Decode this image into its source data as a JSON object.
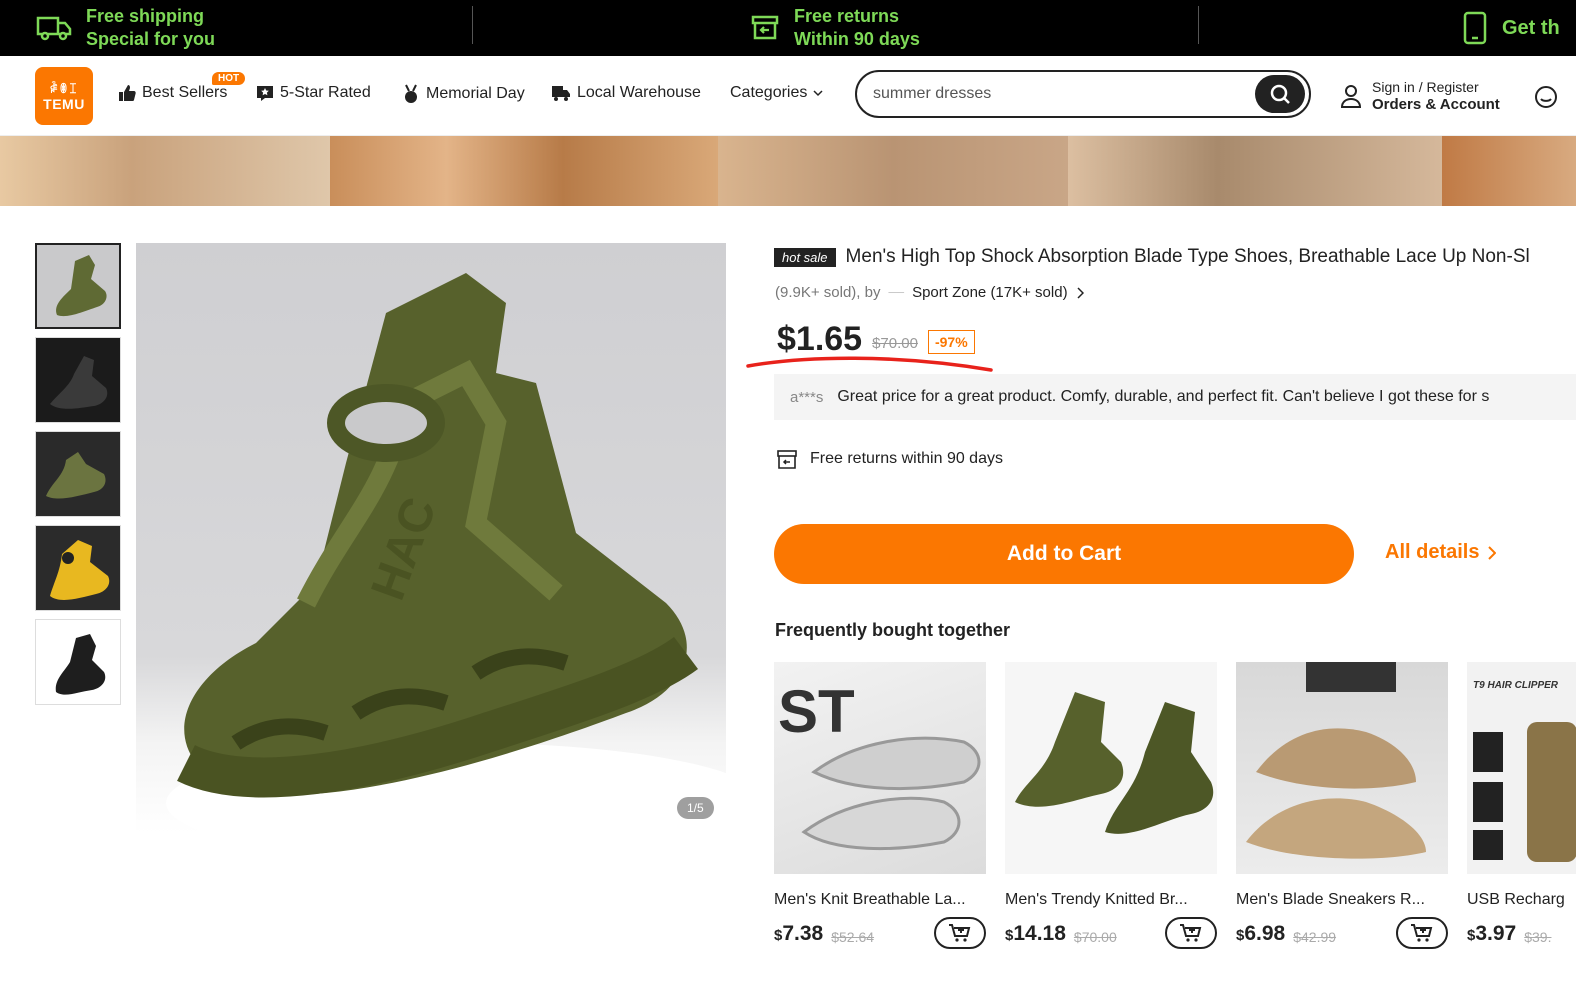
{
  "promo": {
    "shipping": {
      "line1": "Free shipping",
      "line2": "Special for you"
    },
    "returns": {
      "line1": "Free returns",
      "line2": "Within 90 days"
    },
    "app": {
      "line1": "Get th"
    }
  },
  "header": {
    "logo": {
      "line1": "ꍁꂦꀤ",
      "line2": "TEMU"
    },
    "nav": {
      "best_sellers": "Best Sellers",
      "hot_badge": "HOT",
      "five_star": "5-Star Rated",
      "memorial_day": "Memorial Day",
      "local_warehouse": "Local Warehouse",
      "categories": "Categories"
    },
    "search": {
      "value": "summer dresses"
    },
    "account": {
      "line1": "Sign in / Register",
      "line2": "Orders & Account"
    }
  },
  "product": {
    "badge": "hot sale",
    "title": "Men's High Top Shock Absorption Blade Type Shoes, Breathable Lace Up Non-Sl",
    "sold": "(9.9K+ sold), by",
    "store": "Sport Zone (17K+ sold)",
    "price": "$1.65",
    "original_price": "$70.00",
    "discount": "-97%",
    "review_user": "a***s",
    "review_text": "Great price for a great product. Comfy, durable, and perfect fit. Can't believe I got these for s",
    "returns": "Free returns within 90 days",
    "add_to_cart": "Add to Cart",
    "all_details": "All details",
    "image_counter": "1/5"
  },
  "fbt": {
    "title": "Frequently bought together",
    "items": [
      {
        "name": "Men's Knit Breathable La...",
        "currency": "$",
        "price": "7.38",
        "orig": "$52.64"
      },
      {
        "name": "Men's Trendy Knitted Br...",
        "currency": "$",
        "price": "14.18",
        "orig": "$70.00"
      },
      {
        "name": "Men's Blade Sneakers R...",
        "currency": "$",
        "price": "6.98",
        "orig": "$42.99"
      },
      {
        "name": "USB Recharg",
        "currency": "$",
        "price": "3.97",
        "orig": "$39.",
        "pic_text": "T9 HAIR CLIPPER"
      }
    ]
  },
  "colors": {
    "accent": "#fb7701",
    "promo_green": "#7ed957",
    "dark": "#222222"
  }
}
